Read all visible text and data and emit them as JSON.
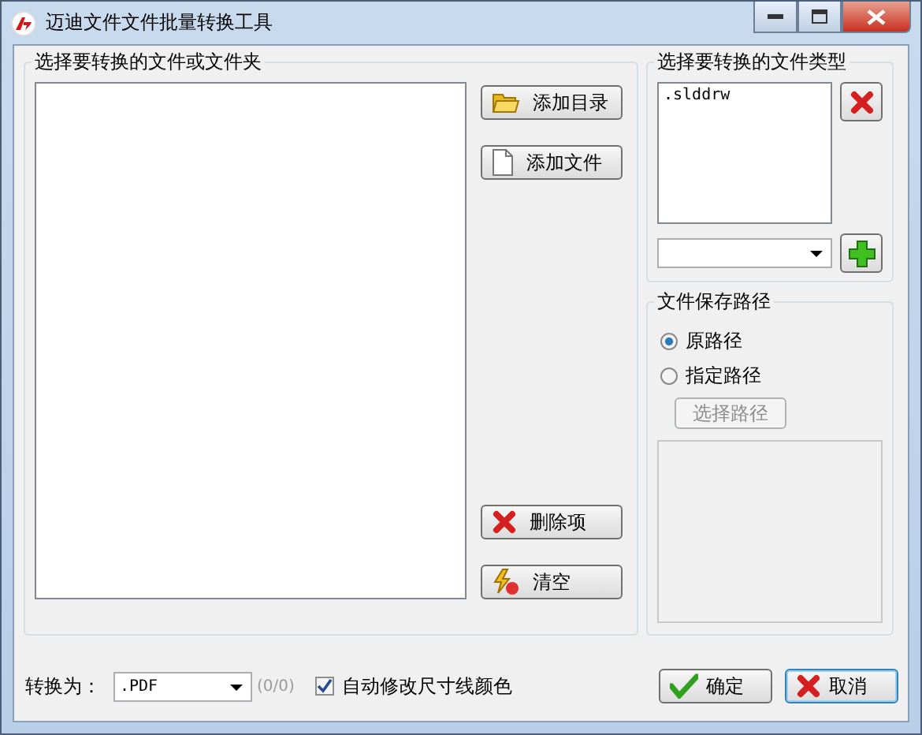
{
  "window": {
    "title": "迈迪文件文件批量转换工具"
  },
  "files_group": {
    "title": "选择要转换的文件或文件夹",
    "top_buttons": [
      {
        "label": "添加目录",
        "kind": "folder"
      },
      {
        "label": "添加文件",
        "kind": "file"
      }
    ],
    "bottom_buttons": [
      {
        "label": "删除项",
        "kind": "delete"
      },
      {
        "label": "清空",
        "kind": "clear"
      }
    ]
  },
  "types_group": {
    "title": "选择要转换的文件类型",
    "items": [
      ".slddrw"
    ]
  },
  "save_path": {
    "title": "文件保存路径",
    "options": [
      {
        "label": "原路径",
        "selected": true
      },
      {
        "label": "指定路径",
        "selected": false
      }
    ],
    "choose_button": {
      "label": "选择路径",
      "disabled": true
    }
  },
  "bottom": {
    "convert_label": "转换为：",
    "format": ".PDF",
    "count": "(0/0)",
    "auto_color": {
      "label": "自动修改尺寸线颜色",
      "checked": true
    }
  },
  "buttons": [
    {
      "label": "确定",
      "kind": "ok",
      "focused": false
    },
    {
      "label": "取消",
      "kind": "cancel",
      "focused": true
    }
  ]
}
